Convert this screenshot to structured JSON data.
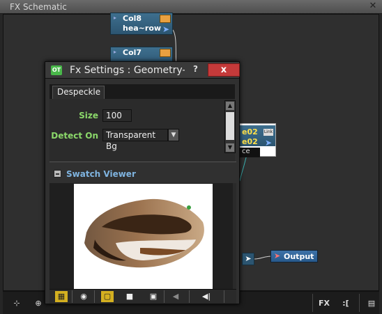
{
  "schematic": {
    "title": "FX Schematic",
    "close_glyph": "✕",
    "nodes": [
      {
        "name": "Col8",
        "sub": "hea~row"
      },
      {
        "name": "Col7",
        "sub": ""
      }
    ],
    "right_node": {
      "line1": "e02",
      "line2": "e02",
      "link_label": "Link",
      "footer": "ce"
    },
    "output_label": "Output",
    "bottom_toolbar": {
      "fit_icon": "fit-icon",
      "zoom_icon": "zoom-plus-icon",
      "fx_label": "FX",
      "toggle_label": ":[",
      "panel_icon": "panel-icon"
    }
  },
  "dialog": {
    "title": "Fx Settings : Geometry-...",
    "logo": "OT",
    "help_label": "?",
    "close_label": "x",
    "tab": "Despeckle",
    "fields": {
      "size_label": "Size",
      "size_value": "100",
      "detect_label": "Detect On",
      "detect_value": "Transparent Bg"
    },
    "swatch": {
      "title": "Swatch Viewer"
    },
    "toolbar": {
      "icons": [
        "checkerboard-icon",
        "eye-icon",
        "white-bg-icon",
        "black-bg-icon",
        "checker-bg-icon",
        "prev-frame-icon",
        "first-frame-icon"
      ]
    }
  },
  "colors": {
    "node_fill": "#2c5571",
    "output_fill": "#285a8c",
    "close_button": "#c43a3a",
    "label_green": "#8bd86a",
    "swatch_title": "#7fb4e0"
  }
}
